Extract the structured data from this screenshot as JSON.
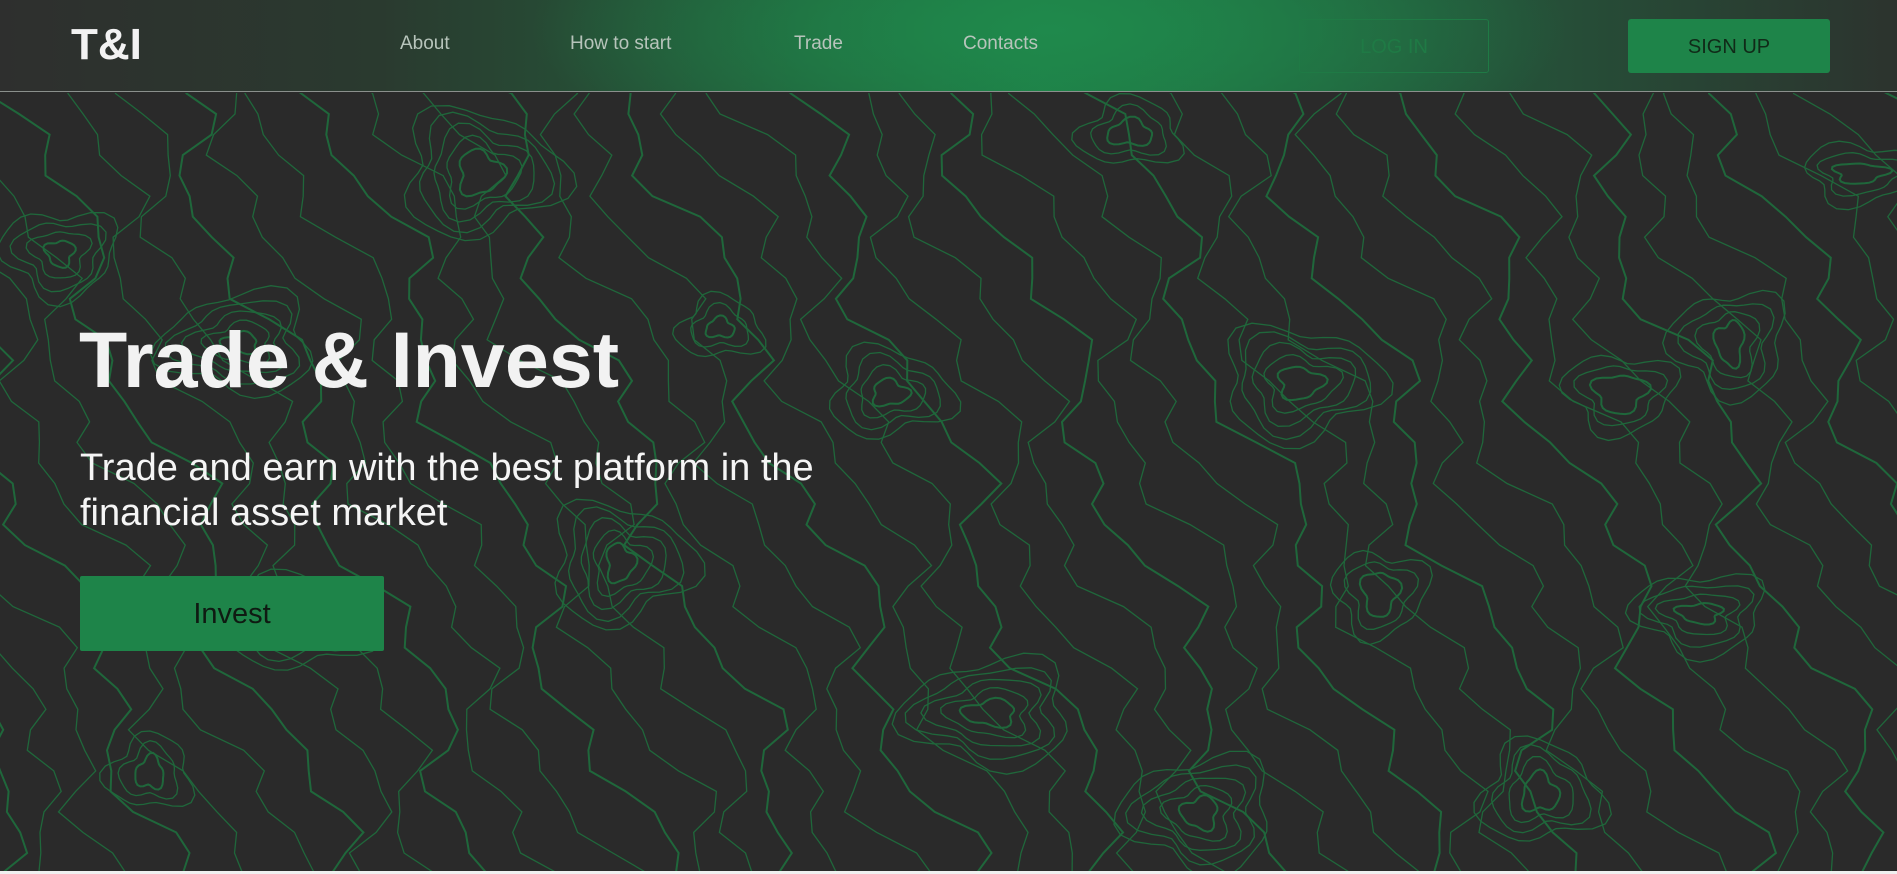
{
  "header": {
    "logo": "T&I",
    "nav": [
      {
        "label": "About"
      },
      {
        "label": "How to start"
      },
      {
        "label": "Trade"
      },
      {
        "label": "Contacts"
      }
    ],
    "login_label": "LOG IN",
    "signup_label": "SIGN UP"
  },
  "hero": {
    "title": "Trade & Invest",
    "subtitle": "Trade and earn with the best platform in the financial asset market",
    "cta_label": "Invest"
  },
  "colors": {
    "accent": "#1e8449",
    "background": "#2a2a2a",
    "contour_line": "#1f6b3c"
  },
  "background_pattern": "topographic-contour-lines"
}
